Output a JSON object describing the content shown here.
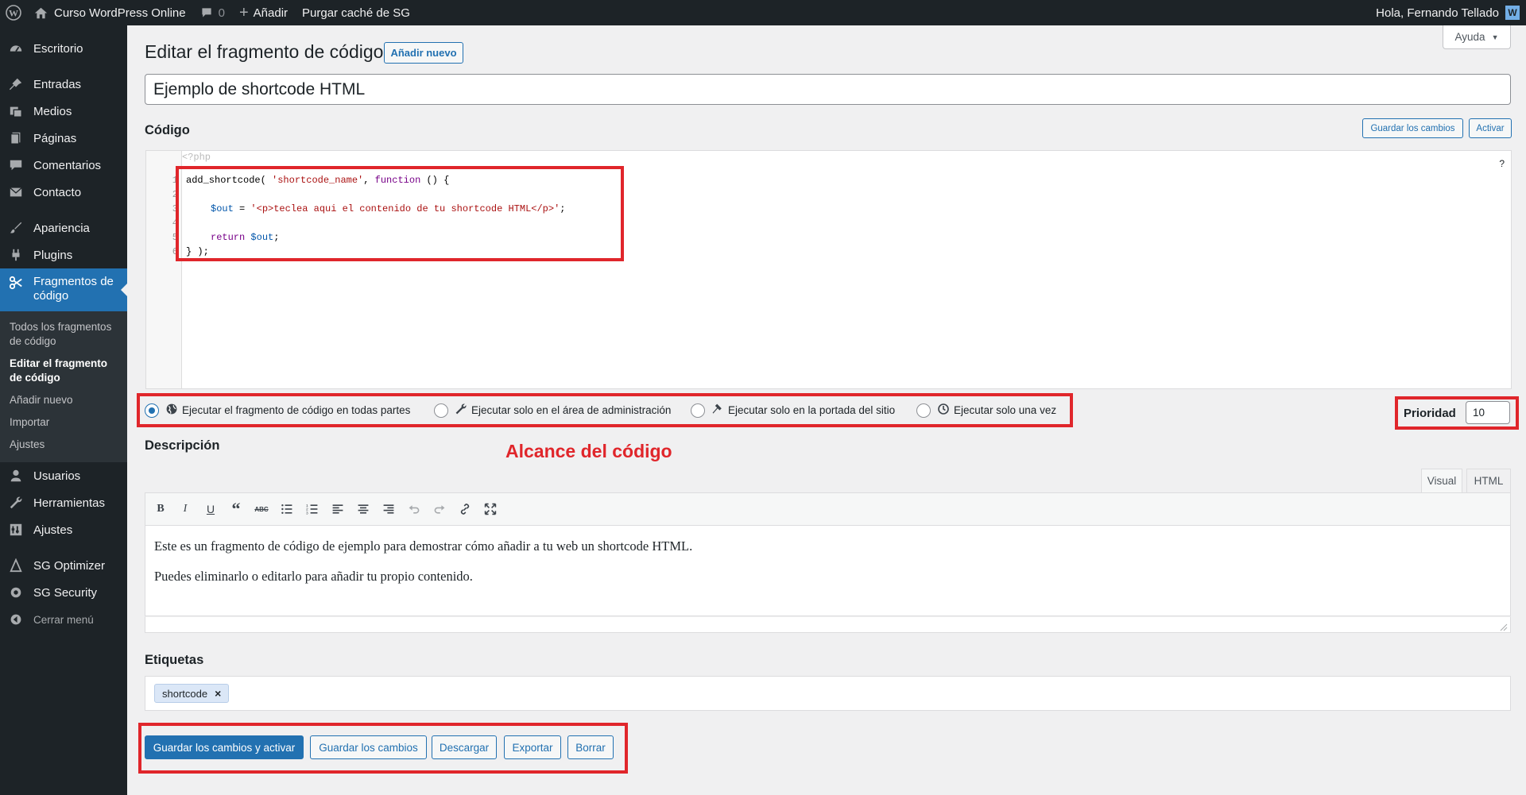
{
  "adminbar": {
    "site_name": "Curso WordPress Online",
    "comments_count": "0",
    "add_new": "Añadir",
    "purge_cache": "Purgar caché de SG",
    "greeting": "Hola, Fernando Tellado",
    "avatar_letter": "W"
  },
  "sidebar": {
    "items": [
      {
        "label": "Escritorio",
        "icon": "dashboard-icon"
      },
      {
        "label": "Entradas",
        "icon": "pin-icon"
      },
      {
        "label": "Medios",
        "icon": "media-icon"
      },
      {
        "label": "Páginas",
        "icon": "page-icon"
      },
      {
        "label": "Comentarios",
        "icon": "comment-icon"
      },
      {
        "label": "Contacto",
        "icon": "mail-icon"
      },
      {
        "label": "Apariencia",
        "icon": "brush-icon"
      },
      {
        "label": "Plugins",
        "icon": "plugin-icon"
      },
      {
        "label": "Fragmentos de código",
        "icon": "scissors-icon"
      },
      {
        "label": "Usuarios",
        "icon": "user-icon"
      },
      {
        "label": "Herramientas",
        "icon": "wrench-icon"
      },
      {
        "label": "Ajustes",
        "icon": "settings-icon"
      },
      {
        "label": "SG Optimizer",
        "icon": "sg-optimizer-icon"
      },
      {
        "label": "SG Security",
        "icon": "sg-security-icon"
      },
      {
        "label": "Cerrar menú",
        "icon": "collapse-icon"
      }
    ],
    "submenu": [
      "Todos los fragmentos de código",
      "Editar el fragmento de código",
      "Añadir nuevo",
      "Importar",
      "Ajustes"
    ]
  },
  "page": {
    "help": "Ayuda",
    "title": "Editar el fragmento de código",
    "add_new": "Añadir nuevo",
    "snippet_name": "Ejemplo de shortcode HTML",
    "code_heading": "Código",
    "save_changes": "Guardar los cambios",
    "activate": "Activar",
    "help_mark": "?"
  },
  "code": {
    "php_open": "<?php",
    "line_numbers": [
      "1",
      "2",
      "3",
      "4",
      "5",
      "6"
    ],
    "lines": [
      {
        "a": "add_shortcode( ",
        "s": "'shortcode_name'",
        "b": ", ",
        "k": "function",
        "c": " () {"
      },
      {
        "v": "$out",
        "b": " = ",
        "s": "'<p>teclea aqui el contenido de tu shortcode HTML</p>'",
        "c": ";"
      },
      {
        "k": "return",
        "b": " ",
        "v": "$out",
        "c": ";"
      },
      {
        "c": "} );"
      }
    ]
  },
  "scope": {
    "options": [
      {
        "label": "Ejecutar el fragmento de código en todas partes",
        "icon": "globe-icon",
        "checked": true
      },
      {
        "label": "Ejecutar solo en el área de administración",
        "icon": "wrench-icon",
        "checked": false
      },
      {
        "label": "Ejecutar solo en la portada del sitio",
        "icon": "hammer-icon",
        "checked": false
      },
      {
        "label": "Ejecutar solo una vez",
        "icon": "clock-icon",
        "checked": false
      }
    ],
    "priority_label": "Prioridad",
    "priority_value": "10",
    "annotation": "Alcance del código"
  },
  "description": {
    "heading": "Descripción",
    "tab_visual": "Visual",
    "tab_html": "HTML",
    "toolbar": [
      "bold-icon",
      "italic-icon",
      "underline-icon",
      "blockquote-icon",
      "strikethrough-icon",
      "bullet-list-icon",
      "numbered-list-icon",
      "align-left-icon",
      "align-center-icon",
      "align-right-icon",
      "undo-icon",
      "redo-icon",
      "link-icon",
      "fullscreen-icon"
    ],
    "paragraph1": "Este es un fragmento de código de ejemplo para demostrar cómo añadir a tu web un shortcode HTML.",
    "paragraph2": "Puedes eliminarlo o editarlo para añadir tu propio contenido."
  },
  "tags": {
    "heading": "Etiquetas",
    "items": [
      "shortcode"
    ],
    "remove": "×"
  },
  "actions": {
    "save_activate": "Guardar los cambios y activar",
    "save": "Guardar los cambios",
    "download": "Descargar",
    "export": "Exportar",
    "delete": "Borrar"
  }
}
